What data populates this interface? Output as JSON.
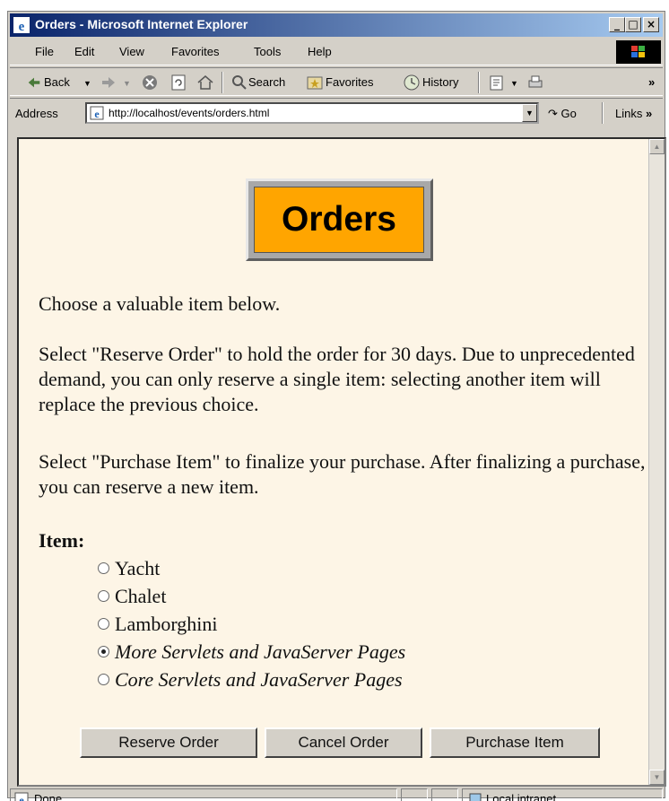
{
  "window": {
    "title": "Orders - Microsoft Internet Explorer",
    "minimize": "_",
    "maximize": "□",
    "close": "×"
  },
  "menubar": {
    "items": [
      "File",
      "Edit",
      "View",
      "Favorites",
      "Tools",
      "Help"
    ]
  },
  "toolbar": {
    "back_label": "Back",
    "search_label": "Search",
    "favorites_label": "Favorites",
    "history_label": "History",
    "more": "»"
  },
  "addressbar": {
    "label": "Address",
    "url": "http://localhost/events/orders.html",
    "go_label": "Go",
    "links_label": "Links",
    "links_more": "»"
  },
  "page": {
    "heading": "Orders",
    "intro": "Choose a valuable item below.",
    "reserve_info": "Select \"Reserve Order\" to hold the order for 30 days. Due to unprecedented demand, you can only reserve a single item: selecting another item will replace the previous choice.",
    "purchase_info": "Select \"Purchase Item\" to finalize your purchase. After finalizing a purchase, you can reserve a new item.",
    "item_label": "Item:",
    "items": [
      {
        "label": "Yacht",
        "selected": false
      },
      {
        "label": "Chalet",
        "selected": false
      },
      {
        "label": "Lamborghini",
        "selected": false
      },
      {
        "label": "More Servlets and JavaServer Pages",
        "selected": true
      },
      {
        "label": "Core Servlets and JavaServer Pages",
        "selected": false
      }
    ],
    "buttons": {
      "reserve": "Reserve Order",
      "cancel": "Cancel Order",
      "purchase": "Purchase Item"
    }
  },
  "statusbar": {
    "status": "Done",
    "zone": "Local intranet"
  }
}
